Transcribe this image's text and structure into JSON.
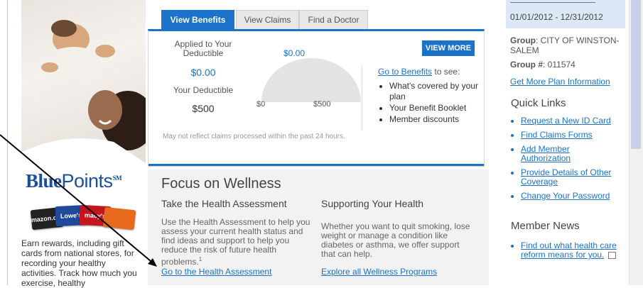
{
  "tabs": [
    "View Benefits",
    "View Claims",
    "Find a Doctor"
  ],
  "benefits": {
    "applied_label": "Applied to  Your Deductible",
    "applied_value": "$0.00",
    "deductible_label": "Your Deductible",
    "deductible_value": "$500",
    "gauge_top": "$0.00",
    "gauge_min": "$0",
    "gauge_max": "$500",
    "gauge_fraction": 0,
    "view_more": "VIEW MORE",
    "goto_link": "Go to Benefits",
    "goto_suffix": " to see:",
    "bullets": [
      "What's covered by your plan",
      "Your Benefit Booklet",
      "Member discounts"
    ],
    "disclaimer": "May not reflect claims processed within the past 24 hours."
  },
  "bluepoints": {
    "logo_bold": "Blue",
    "logo_thin": "Points",
    "logo_mark": "SM",
    "cards": [
      "amazon.com",
      "Lowe's",
      "macy's",
      ""
    ],
    "text": "Earn rewards, including gift cards from national stores, for recording your healthy activities. Track how much you exercise, healthy"
  },
  "wellness": {
    "title": "Focus on Wellness",
    "left_heading": "Take the Health Assessment",
    "left_body": "Use the Health Assessment to help you assess your current health status and find ideas and support to help you reduce the risk of future health problems.",
    "left_footnote": "1",
    "left_link": "Go to the Health Assessment",
    "right_heading": "Supporting Your Health",
    "right_body": "Whether you want to quit smoking, lose weight or manage a condition like diabetes or asthma, we offer support that can help.",
    "right_link": "Explore all Wellness Programs"
  },
  "sidebar": {
    "plan_dates": "01/01/2012 - 12/31/2012",
    "group_label": "Group",
    "group_value": ": CITY OF WINSTON-SALEM",
    "group_num_label": "Group #",
    "group_num_value": ": 011574",
    "more_info_link": "Get More Plan Information",
    "quick_links_title": "Quick Links",
    "quick_links": [
      "Request a New ID Card",
      "Find Claims Forms",
      "Add Member Authorization",
      "Provide Details of Other Coverage",
      "Change Your Password"
    ],
    "news_title": "Member News",
    "news_items": [
      "Find out what health care reform means for you."
    ]
  }
}
